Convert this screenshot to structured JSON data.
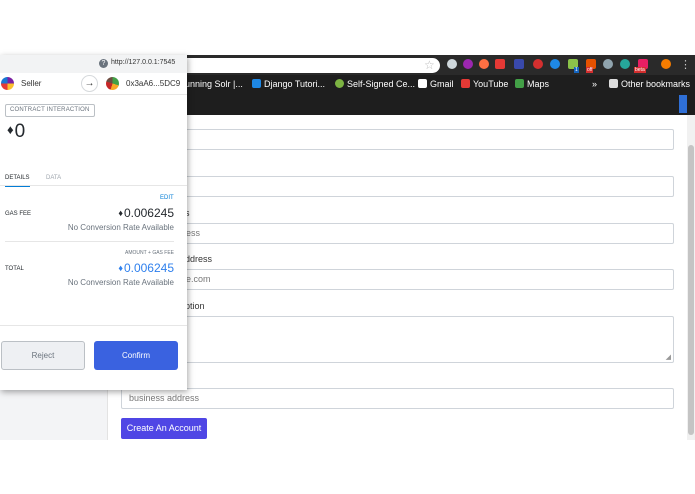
{
  "browser": {
    "bookmarks": [
      {
        "label": "unning Solr |...",
        "color": "#000000"
      },
      {
        "label": "Django Tutori...",
        "color": "#1e88e5"
      },
      {
        "label": "Self-Signed Ce...",
        "color": "#7cb342"
      },
      {
        "label": "Gmail",
        "color": "#e53935"
      },
      {
        "label": "YouTube",
        "color": "#e53935"
      },
      {
        "label": "Maps",
        "color": "#43a047"
      },
      {
        "label": "»",
        "color": ""
      },
      {
        "label": "Other bookmarks",
        "color": "#dddddd"
      }
    ],
    "extension_badge_off": "off",
    "extension_badge_beta": "beta",
    "extension_badge_1": "1"
  },
  "page": {
    "label_business_name": "s",
    "placeholder_business_name": "ess",
    "label_email": "ddress",
    "placeholder_email": "e.com",
    "label_description": "ption",
    "placeholder_address": "business address",
    "create_button": "Create An Account"
  },
  "metamask": {
    "url": "http://127.0.0.1:7545",
    "from_account": "Seller",
    "to_address": "0x3aA6...5DC9",
    "badge": "CONTRACT INTERACTION",
    "amount": "0",
    "eth_symbol": "♦",
    "tabs": [
      "DETAILS",
      "DATA"
    ],
    "edit_label": "EDIT",
    "gas_fee_label": "GAS FEE",
    "gas_fee_value": "0.006245",
    "no_conversion": "No Conversion Rate Available",
    "amount_gas_caption": "AMOUNT + GAS FEE",
    "total_label": "TOTAL",
    "total_value": "0.006245",
    "reject_button": "Reject",
    "confirm_button": "Confirm",
    "colors": {
      "confirm": "#3a62e0",
      "total": "#2f80ed",
      "link": "#037dd6"
    }
  }
}
